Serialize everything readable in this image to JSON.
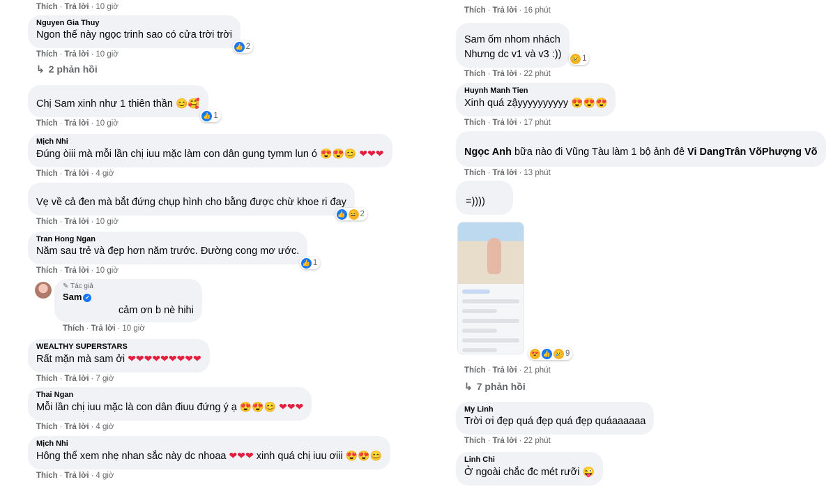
{
  "left": {
    "c0": {
      "meta": {
        "like": "Thích",
        "reply": "Trả lời",
        "time": "10 giờ"
      }
    },
    "c1": {
      "author": "Nguyen Gia Thuy",
      "text": "Ngon thế này ngọc trinh sao có cửa trời trời",
      "reaction_count": "2",
      "meta": {
        "like": "Thích",
        "reply": "Trả lời",
        "time": "10 giờ"
      },
      "replies": "2 phản hồi"
    },
    "c2": {
      "text": "Chị Sam xinh như 1 thiên thần",
      "emoji": "😊🥰",
      "reaction_count": "1",
      "meta": {
        "like": "Thích",
        "reply": "Trả lời",
        "time": "10 giờ"
      }
    },
    "c3": {
      "author": "Mịch Nhi",
      "text": "Đúng òiii mà mỗi lần chị iuu mặc làm con dân gung tymm lun ó",
      "emoji": "😍😍😊",
      "hearts": "❤❤❤",
      "meta": {
        "like": "Thích",
        "reply": "Trả lời",
        "time": "4 giờ"
      }
    },
    "c4": {
      "text": "Vẹ về cả đen mà bắt đứng chụp hình cho bằng được chừ khoe ri đay",
      "reaction_count": "2",
      "meta": {
        "like": "Thích",
        "reply": "Trả lời",
        "time": "10 giờ"
      }
    },
    "c5": {
      "author": "Tran Hong Ngan",
      "text": "Năm sau trẻ và đẹp hơn năm trước. Đường cong mơ ước.",
      "reaction_count": "1",
      "meta": {
        "like": "Thích",
        "reply": "Trả lời",
        "time": "10 giờ"
      }
    },
    "c6": {
      "badge": "Tác giả",
      "author": "Sam",
      "text": "cảm ơn b nè hihi",
      "meta": {
        "like": "Thích",
        "reply": "Trả lời",
        "time": "10 giờ"
      }
    },
    "c7": {
      "author": "WEALTHY SUPERSTARS",
      "text": "Rất mặn mà sam ởi",
      "hearts": "❤❤❤❤❤❤❤❤❤",
      "meta": {
        "like": "Thích",
        "reply": "Trả lời",
        "time": "7 giờ"
      }
    },
    "c8": {
      "author": "Thai Ngan",
      "text": "Mỗi lần chị iuu mặc là con dân điuu đứng ý ạ",
      "emoji": "😍😍😊",
      "hearts": "❤❤❤",
      "meta": {
        "like": "Thích",
        "reply": "Trả lời",
        "time": "4 giờ"
      }
    },
    "c9": {
      "author": "Mịch Nhi",
      "text": "Hông thể xem nhẹ nhan sắc này dc nhoaa",
      "hearts": "❤❤❤",
      "text2": "xinh quá chị iuu ơiii",
      "emoji": "😍😍😊",
      "meta": {
        "like": "Thích",
        "reply": "Trả lời",
        "time": "4 giờ"
      }
    }
  },
  "right": {
    "r0": {
      "meta": {
        "like": "Thích",
        "reply": "Trả lời",
        "time": "16 phút"
      }
    },
    "r1": {
      "line1": "Sam ốm nhom nhách",
      "line2": "Nhưng dc v1 và v3 :))",
      "reaction_count": "1",
      "meta": {
        "like": "Thích",
        "reply": "Trả lời",
        "time": "22 phút"
      }
    },
    "r2": {
      "author": "Huynh Manh Tien",
      "text": "Xinh quá zậyyyyyyyyyy",
      "emoji": "😍😍😍",
      "meta": {
        "like": "Thích",
        "reply": "Trả lời",
        "time": "17 phút"
      }
    },
    "r3": {
      "tag1": "Ngọc Anh",
      "text": " bữa nào đi Vũng Tàu làm 1 bộ ảnh đê ",
      "tag2": "Vi DangTrân VõPhượng Võ",
      "meta": {
        "like": "Thích",
        "reply": "Trả lời",
        "time": "13 phút"
      }
    },
    "r4": {
      "text": "=))))",
      "reaction_count": "9",
      "meta": {
        "like": "Thích",
        "reply": "Trả lời",
        "time": "21 phút"
      },
      "replies": "7 phản hồi"
    },
    "r5": {
      "author": "My Linh",
      "text": "Trời ơi đẹp quá đẹp quá đẹp quáaaaaaa",
      "meta": {
        "like": "Thích",
        "reply": "Trả lời",
        "time": "22 phút"
      }
    },
    "r6": {
      "author": "Linh Chi",
      "text": "Ở ngoài chắc đc mét rưỡi",
      "emoji": "😜"
    }
  }
}
